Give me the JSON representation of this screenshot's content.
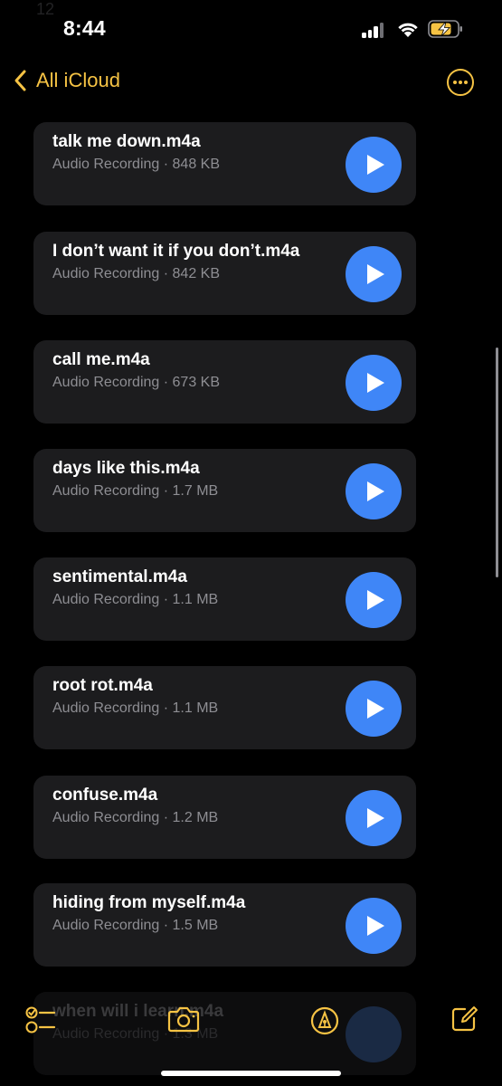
{
  "status_bar": {
    "time": "8:44",
    "ghost_text": "12"
  },
  "nav": {
    "back_label": "All iCloud"
  },
  "colors": {
    "accent": "#f6c344",
    "play": "#3f86f7",
    "card": "#1c1c1e"
  },
  "attachments": [
    {
      "title": "talk me down.m4a",
      "subtitle": "Audio Recording · 848 KB"
    },
    {
      "title": "I don’t want it if you don’t.m4a",
      "subtitle": "Audio Recording · 842 KB"
    },
    {
      "title": "call me.m4a",
      "subtitle": "Audio Recording · 673 KB"
    },
    {
      "title": "days like this.m4a",
      "subtitle": "Audio Recording · 1.7 MB"
    },
    {
      "title": "sentimental.m4a",
      "subtitle": "Audio Recording · 1.1 MB"
    },
    {
      "title": "root rot.m4a",
      "subtitle": "Audio Recording · 1.1 MB"
    },
    {
      "title": "confuse.m4a",
      "subtitle": "Audio Recording · 1.2 MB"
    },
    {
      "title": "hiding from myself.m4a",
      "subtitle": "Audio Recording · 1.5 MB"
    }
  ],
  "partial_attachment": {
    "title": "when will i learn.m4a",
    "subtitle": "Audio Recording · 1.3 MB"
  },
  "toolbar": {
    "icons": [
      "checklist-icon",
      "camera-icon",
      "markup-pen-icon",
      "compose-icon"
    ]
  }
}
